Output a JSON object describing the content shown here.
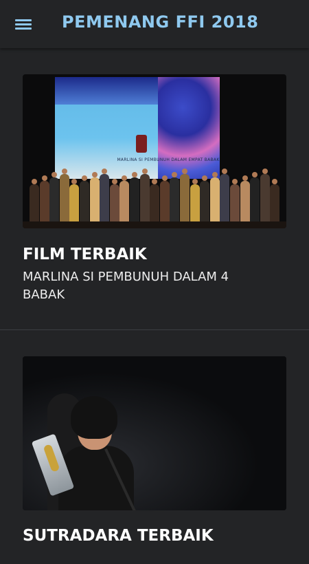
{
  "app_title": "PEMENANG FFI 2018",
  "cards": [
    {
      "title": "FILM TERBAIK",
      "subtitle": "MARLINA SI PEMBUNUH DALAM 4 BABAK",
      "photo_caption": "MARLINA SI PEMBUNUH DALAM EMPAT BABAK"
    },
    {
      "title": "SUTRADARA TERBAIK"
    }
  ],
  "colors": {
    "background": "#232426",
    "accent": "#8fc9ef",
    "text": "#ffffff"
  },
  "icons": {
    "menu": "hamburger-menu-icon"
  }
}
